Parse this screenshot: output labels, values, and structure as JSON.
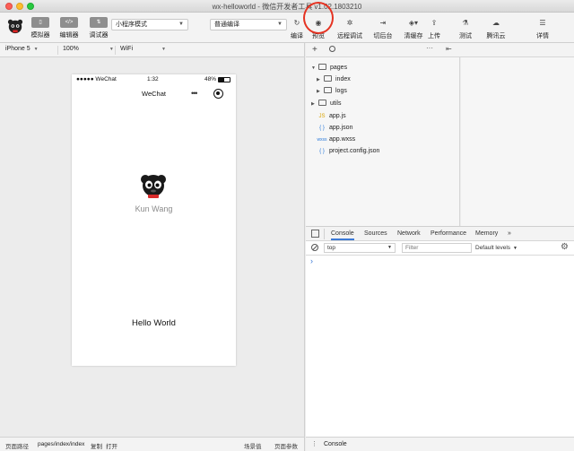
{
  "window": {
    "title": "wx-helloworld - 微信开发者工具 v1.02.1803210"
  },
  "toolbar": {
    "simulator_label": "模拟器",
    "editor_label": "编辑器",
    "debugger_label": "调试器",
    "mode_select": "小程序模式",
    "compile_select": "普通编译",
    "compile_label": "编译",
    "preview_label": "预览",
    "remote_debug_label": "远程调试",
    "background_label": "切后台",
    "clear_cache_label": "清缓存",
    "upload_label": "上传",
    "test_label": "测试",
    "tencent_cloud_label": "腾讯云",
    "details_label": "详情",
    "editor_icon_text": "</>",
    "accent_ring_color": "#e53322"
  },
  "device_bar": {
    "device": "iPhone 5",
    "zoom": "100%",
    "network": "WiFi"
  },
  "phone": {
    "carrier": "●●●●● WeChat",
    "time": "1:32",
    "battery": "48%",
    "nav_title": "WeChat",
    "username": "Kun Wang",
    "hello": "Hello World"
  },
  "file_tree": {
    "items": [
      {
        "name": "pages",
        "type": "folder",
        "expanded": true
      },
      {
        "name": "index",
        "type": "folder"
      },
      {
        "name": "logs",
        "type": "folder"
      },
      {
        "name": "utils",
        "type": "folder"
      },
      {
        "name": "app.js",
        "type": "js",
        "icon_text": "JS"
      },
      {
        "name": "app.json",
        "type": "json",
        "icon_text": "{ }"
      },
      {
        "name": "app.wxss",
        "type": "wxss",
        "icon_text": "wxss"
      },
      {
        "name": "project.config.json",
        "type": "json",
        "icon_text": "{ }"
      }
    ]
  },
  "devtools": {
    "tabs": [
      "Console",
      "Sources",
      "Network",
      "Performance",
      "Memory",
      "»"
    ],
    "context": "top",
    "filter_placeholder": "Filter",
    "levels": "Default levels",
    "prompt": "›",
    "bottom_tab": "Console"
  },
  "status_bar": {
    "path_label": "页面路径",
    "path": "pages/index/index",
    "copy": "复制",
    "open": "打开",
    "scene": "场景值",
    "params": "页面参数"
  }
}
